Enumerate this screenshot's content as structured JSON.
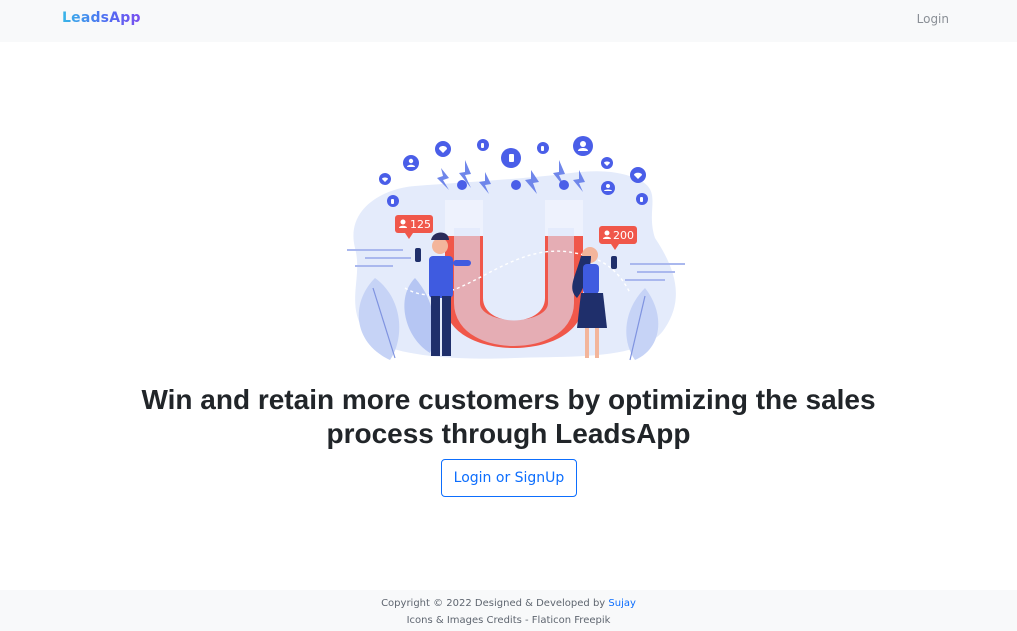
{
  "navbar": {
    "brand": "LeadsApp",
    "login_link": "Login"
  },
  "hero": {
    "illustration": {
      "badge_left": "125",
      "badge_right": "200",
      "icons": [
        "heart-icon",
        "like-icon",
        "user-icon",
        "lightning-icon",
        "magnet-icon"
      ],
      "colors": {
        "primary": "#4a5ee8",
        "accent_red": "#f0574a",
        "light_blue": "#dde6fb",
        "navy": "#1f2f6b"
      }
    },
    "headline_line1": "Win and retain more customers by optimizing the sales",
    "headline_line2": "process through LeadsApp",
    "cta_label": "Login or SignUp"
  },
  "footer": {
    "copyright_prefix": "Copyright © 2022 Designed & Developed by ",
    "author": "Sujay",
    "credits": "Icons & Images Credits - Flaticon Freepik"
  }
}
